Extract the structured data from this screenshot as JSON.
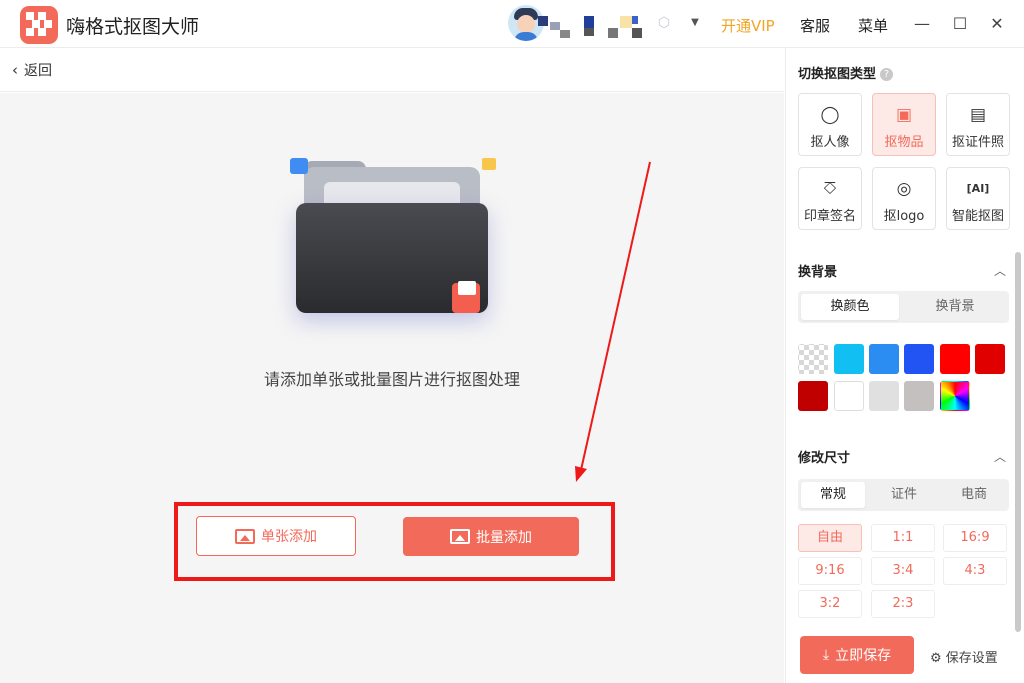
{
  "app": {
    "title": "嗨格式抠图大师"
  },
  "header": {
    "vip_label": "开通VIP",
    "service_label": "客服",
    "menu_label": "菜单",
    "minimize": "—",
    "maximize": "☐",
    "close": "✕"
  },
  "nav": {
    "back_label": "返回"
  },
  "main": {
    "hint": "请添加单张或批量图片进行抠图处理",
    "single_add_label": "单张添加",
    "batch_add_label": "批量添加"
  },
  "panel": {
    "type_title": "切换抠图类型",
    "types": [
      {
        "label": "抠人像",
        "icon": "person-icon",
        "active": false
      },
      {
        "label": "抠物品",
        "icon": "box-icon",
        "active": true
      },
      {
        "label": "抠证件照",
        "icon": "id-card-icon",
        "active": false
      },
      {
        "label": "印章签名",
        "icon": "stamp-icon",
        "active": false
      },
      {
        "label": "抠logo",
        "icon": "badge-icon",
        "active": false
      },
      {
        "label": "智能抠图",
        "icon": "ai-icon",
        "active": false
      }
    ],
    "background_title": "换背景",
    "bg_tabs": [
      {
        "label": "换颜色",
        "active": true
      },
      {
        "label": "换背景",
        "active": false
      }
    ],
    "colors": [
      "transparent",
      "#12bff2",
      "#2b8cf1",
      "#2254f4",
      "#ff0000",
      "#e00000",
      "#c00000",
      "#ffffff",
      "#e0e0e0",
      "#c4c0c0",
      "rainbow"
    ],
    "size_title": "修改尺寸",
    "size_tabs": [
      {
        "label": "常规",
        "active": true
      },
      {
        "label": "证件",
        "active": false
      },
      {
        "label": "电商",
        "active": false
      }
    ],
    "ratios": [
      {
        "label": "自由",
        "active": true
      },
      {
        "label": "1:1",
        "active": false
      },
      {
        "label": "16:9",
        "active": false
      },
      {
        "label": "9:16",
        "active": false
      },
      {
        "label": "3:4",
        "active": false
      },
      {
        "label": "4:3",
        "active": false
      },
      {
        "label": "3:2",
        "active": false
      },
      {
        "label": "2:3",
        "active": false
      }
    ],
    "save_label": "立即保存",
    "save_settings_label": "保存设置"
  },
  "colors": {
    "accent": "#f26a5a",
    "vip": "#f0a526",
    "annotation": "#ee1a1a"
  }
}
